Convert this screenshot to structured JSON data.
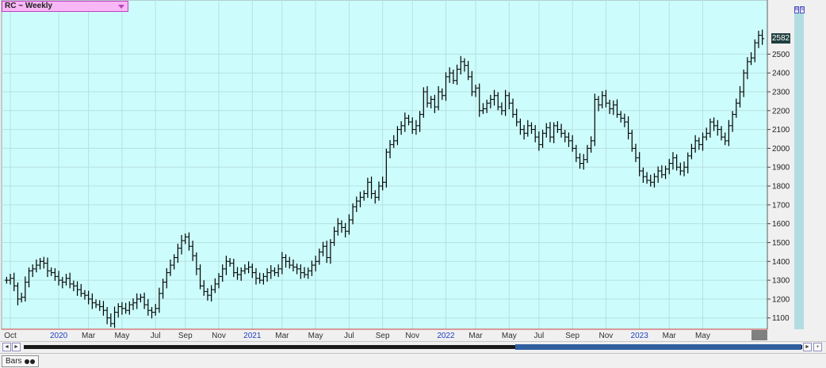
{
  "window": {
    "symbol_label": "RC ~ Weekly",
    "last_price": "2582",
    "status_tab_label": "Bars",
    "mini_buttons": [
      "B",
      "S"
    ]
  },
  "colors": {
    "plot_background": "#ccfdfc",
    "grid": "#b8e0e0",
    "bars": "#000000",
    "axis_line": "#d04040",
    "year_label": "#2040c0",
    "month_label": "#303030",
    "price_tag_bg": "#1f3f3f",
    "right_band": "#b0dde0",
    "cursor_box": "#808080"
  },
  "chart_data": {
    "type": "ohlc-bar",
    "title": "RC ~ Weekly",
    "interval": "Weekly",
    "ylim": [
      1040,
      2720
    ],
    "y_ticks": [
      1100,
      1200,
      1300,
      1400,
      1500,
      1600,
      1700,
      1800,
      1900,
      2000,
      2100,
      2200,
      2300,
      2400,
      2500
    ],
    "last_price": 2582,
    "x_labels": [
      {
        "text": "Oct",
        "week": 1,
        "year": false
      },
      {
        "text": "2020",
        "week": 14,
        "year": true
      },
      {
        "text": "Mar",
        "week": 22,
        "year": false
      },
      {
        "text": "May",
        "week": 31,
        "year": false
      },
      {
        "text": "Jul",
        "week": 40,
        "year": false
      },
      {
        "text": "Sep",
        "week": 48,
        "year": false
      },
      {
        "text": "Nov",
        "week": 57,
        "year": false
      },
      {
        "text": "2021",
        "week": 66,
        "year": true
      },
      {
        "text": "Mar",
        "week": 74,
        "year": false
      },
      {
        "text": "May",
        "week": 83,
        "year": false
      },
      {
        "text": "Jul",
        "week": 92,
        "year": false
      },
      {
        "text": "Sep",
        "week": 101,
        "year": false
      },
      {
        "text": "Nov",
        "week": 109,
        "year": false
      },
      {
        "text": "2022",
        "week": 118,
        "year": true
      },
      {
        "text": "Mar",
        "week": 126,
        "year": false
      },
      {
        "text": "May",
        "week": 135,
        "year": false
      },
      {
        "text": "Jul",
        "week": 143,
        "year": false
      },
      {
        "text": "Sep",
        "week": 152,
        "year": false
      },
      {
        "text": "Nov",
        "week": 161,
        "year": false
      },
      {
        "text": "2023",
        "week": 170,
        "year": true
      },
      {
        "text": "Mar",
        "week": 178,
        "year": false
      },
      {
        "text": "May",
        "week": 187,
        "year": false
      }
    ],
    "closes": [
      1300,
      1310,
      1270,
      1200,
      1210,
      1290,
      1350,
      1360,
      1380,
      1400,
      1390,
      1350,
      1340,
      1320,
      1300,
      1290,
      1310,
      1280,
      1270,
      1250,
      1230,
      1220,
      1200,
      1180,
      1170,
      1160,
      1140,
      1100,
      1070,
      1130,
      1160,
      1150,
      1140,
      1170,
      1180,
      1200,
      1210,
      1170,
      1140,
      1130,
      1150,
      1230,
      1290,
      1340,
      1380,
      1420,
      1470,
      1510,
      1530,
      1480,
      1430,
      1360,
      1270,
      1240,
      1220,
      1250,
      1280,
      1320,
      1360,
      1400,
      1390,
      1340,
      1330,
      1350,
      1360,
      1370,
      1340,
      1310,
      1300,
      1320,
      1340,
      1350,
      1340,
      1360,
      1420,
      1400,
      1380,
      1370,
      1360,
      1340,
      1330,
      1350,
      1380,
      1400,
      1450,
      1480,
      1420,
      1500,
      1560,
      1600,
      1580,
      1560,
      1620,
      1690,
      1720,
      1740,
      1760,
      1820,
      1760,
      1740,
      1800,
      1820,
      1980,
      2020,
      2040,
      2100,
      2120,
      2160,
      2140,
      2100,
      2120,
      2180,
      2300,
      2240,
      2260,
      2220,
      2300,
      2280,
      2380,
      2400,
      2360,
      2420,
      2460,
      2440,
      2380,
      2300,
      2320,
      2200,
      2210,
      2240,
      2260,
      2280,
      2220,
      2200,
      2280,
      2240,
      2180,
      2140,
      2100,
      2080,
      2120,
      2100,
      2060,
      2020,
      2080,
      2110,
      2060,
      2120,
      2100,
      2080,
      2060,
      2040,
      2000,
      1950,
      1920,
      1940,
      2000,
      2040,
      2260,
      2230,
      2280,
      2240,
      2210,
      2230,
      2180,
      2160,
      2140,
      2080,
      2000,
      1950,
      1880,
      1850,
      1830,
      1820,
      1850,
      1880,
      1860,
      1890,
      1920,
      1950,
      1900,
      1880,
      1900,
      1960,
      2000,
      2040,
      2020,
      2060,
      2080,
      2140,
      2120,
      2100,
      2060,
      2040,
      2120,
      2180,
      2240,
      2300,
      2400,
      2460,
      2480,
      2560,
      2600,
      2582
    ]
  }
}
